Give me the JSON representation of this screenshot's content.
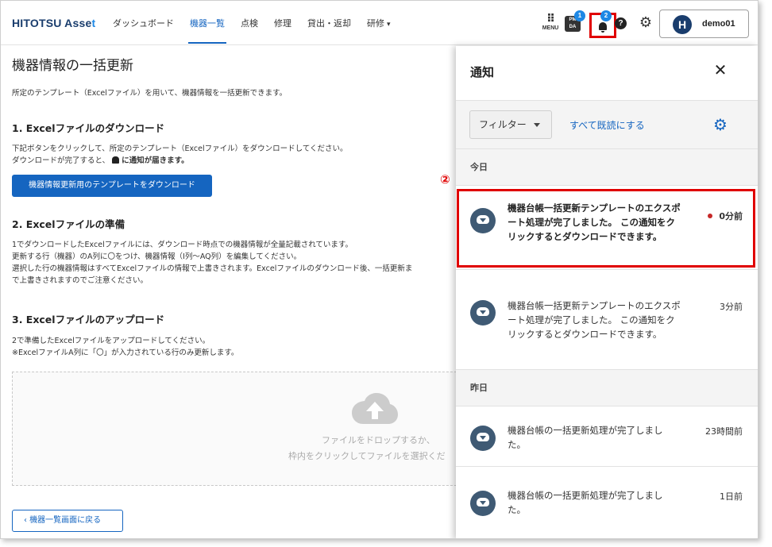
{
  "header": {
    "logo_main": "HITOTSU Asse",
    "logo_accent": "t",
    "nav": [
      {
        "label": "ダッシュボード"
      },
      {
        "label": "機器一覧"
      },
      {
        "label": "点検"
      },
      {
        "label": "修理"
      },
      {
        "label": "貸出・返却"
      },
      {
        "label": "研修"
      }
    ],
    "menu_label": "MENU",
    "pmda_text": "PM\nDA",
    "pmda_badge": "1",
    "bell_badge": "2",
    "help_glyph": "?",
    "gear_glyph": "⚙",
    "avatar_letter": "H",
    "user_name": "demo01"
  },
  "main": {
    "title": "機器情報の一括更新",
    "intro": "所定のテンプレート（Excelファイル）を用いて、機器情報を一括更新できます。",
    "section1": {
      "title": "1. Excelファイルのダウンロード",
      "line1": "下記ボタンをクリックして、所定のテンプレート（Excelファイル）をダウンロードしてください。",
      "line2_pre": "ダウンロードが完了すると、",
      "line2_post": "に通知が届きます。",
      "button": "機器情報更新用のテンプレートをダウンロード"
    },
    "section2": {
      "title": "2. Excelファイルの準備",
      "lines": [
        "1でダウンロードしたExcelファイルには、ダウンロード時点での機器情報が全量記載されています。",
        "更新する行（機器）のA列に〇をつけ、機器情報（I列～AQ列）を編集してください。",
        "選択した行の機器情報はすべてExcelファイルの情報で上書きされます。Excelファイルのダウンロード後、一括更新ま",
        "で上書きされますのでご注意ください。"
      ]
    },
    "section3": {
      "title": "3. Excelファイルのアップロード",
      "line1": "2で準備したExcelファイルをアップロードしてください。",
      "line2": "※ExcelファイルA列に「〇」が入力されている行のみ更新します。"
    },
    "dropzone": {
      "line1": "ファイルをドロップするか、",
      "line2": "枠内をクリックしてファイルを選択くだ"
    },
    "back_button": "機器一覧画面に戻る"
  },
  "panel": {
    "title": "通知",
    "close_glyph": "✕",
    "filter_label": "フィルター",
    "mark_all_read": "すべて既読にする",
    "today_label": "今日",
    "yesterday_label": "昨日",
    "notifications": [
      {
        "text": "機器台帳一括更新テンプレートのエクスポート処理が完了しました。 この通知をクリックするとダウンロードできます。",
        "time": "0分前",
        "unread": true
      },
      {
        "text": "機器台帳一括更新テンプレートのエクスポート処理が完了しました。 この通知をクリックするとダウンロードできます。",
        "time": "3分前",
        "unread": false
      },
      {
        "text": "機器台帳の一括更新処理が完了しました。",
        "time": "23時間前",
        "unread": false
      },
      {
        "text": "機器台帳の一括更新処理が完了しました。",
        "time": "1日前",
        "unread": false
      }
    ]
  },
  "annotation": {
    "step_marker": "②"
  },
  "colors": {
    "primary": "#1565c0",
    "logo_dark": "#1a3d6d",
    "highlight": "#e00000",
    "badge": "#1e88e5",
    "unread_dot": "#c62828"
  }
}
